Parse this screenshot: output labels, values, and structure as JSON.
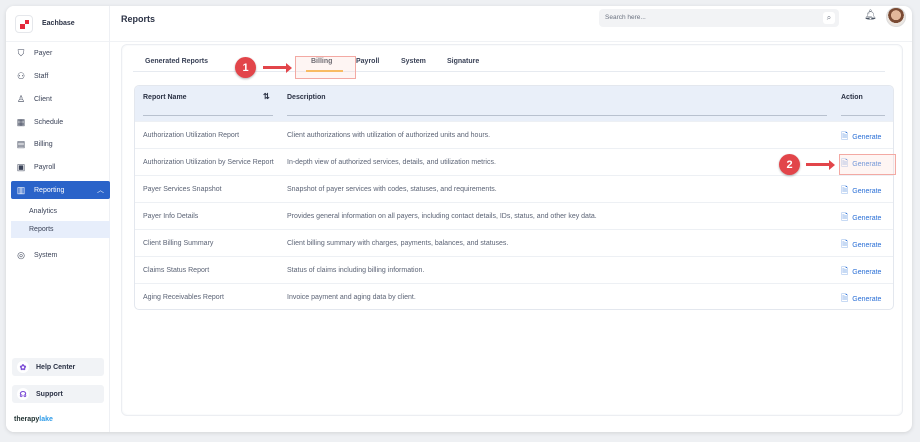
{
  "brand": {
    "name": "Eachbase"
  },
  "sidebar": {
    "items": [
      {
        "label": "Payer",
        "icon": "shield-icon"
      },
      {
        "label": "Staff",
        "icon": "users-icon"
      },
      {
        "label": "Client",
        "icon": "user-icon"
      },
      {
        "label": "Schedule",
        "icon": "calendar-icon"
      },
      {
        "label": "Billing",
        "icon": "receipt-icon"
      },
      {
        "label": "Payroll",
        "icon": "wallet-icon"
      },
      {
        "label": "Reporting",
        "icon": "report-icon"
      }
    ],
    "subitems": [
      {
        "label": "Analytics"
      },
      {
        "label": "Reports"
      }
    ],
    "system": "System",
    "help": "Help Center",
    "support": "Support",
    "footer_a": "therapy",
    "footer_b": "lake"
  },
  "header": {
    "title": "Reports",
    "search_placeholder": "Search here..."
  },
  "tabs": [
    "Generated Reports",
    "Billing",
    "Payroll",
    "System",
    "Signature"
  ],
  "annotations": [
    "1",
    "2"
  ],
  "table": {
    "headers": {
      "name": "Report Name",
      "description": "Description",
      "action": "Action"
    },
    "action_label": "Generate",
    "rows": [
      {
        "name": "Authorization Utilization Report",
        "description": "Client authorizations with utilization of authorized units and hours."
      },
      {
        "name": "Authorization Utilization by Service Report",
        "description": "In-depth view of authorized services, details, and utilization metrics."
      },
      {
        "name": "Payer Services Snapshot",
        "description": "Snapshot of payer services with codes, statuses, and requirements."
      },
      {
        "name": "Payer Info Details",
        "description": "Provides general information on all payers, including contact details, IDs, status, and other key data."
      },
      {
        "name": "Client Billing Summary",
        "description": "Client billing summary with charges, payments, balances, and statuses."
      },
      {
        "name": "Claims Status Report",
        "description": "Status of claims including billing information."
      },
      {
        "name": "Aging Receivables Report",
        "description": "Invoice payment and aging data by client."
      }
    ]
  },
  "colors": {
    "accent": "#2a63c9",
    "annotation": "#e2454a",
    "tab_underline": "#f6a623"
  }
}
